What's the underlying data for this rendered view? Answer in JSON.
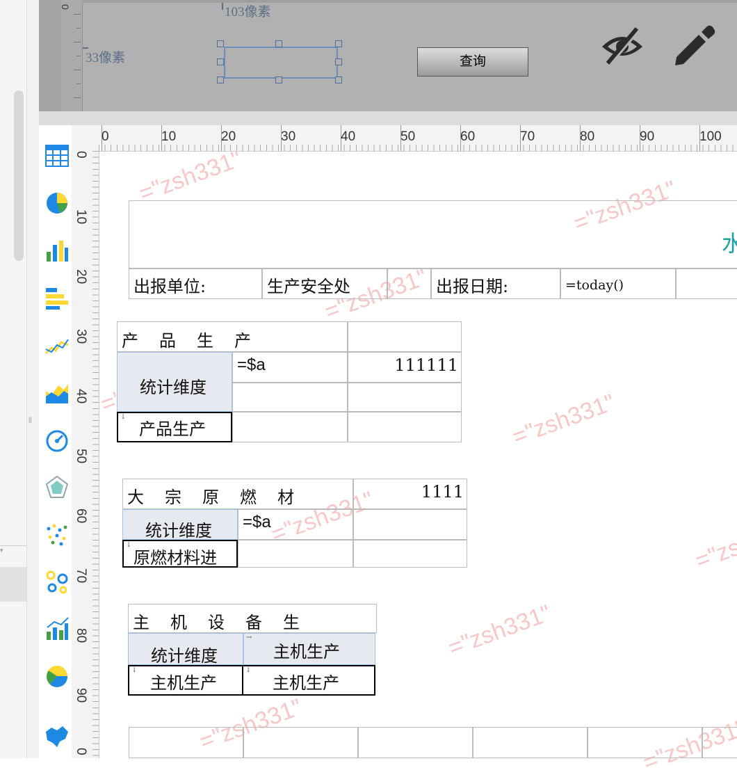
{
  "param_panel": {
    "ruler_top_label": "0",
    "width_label": "103像素",
    "height_label": "33像素",
    "query_button": "查询"
  },
  "ruler": {
    "h_ticks": [
      "0",
      "10",
      "20",
      "30",
      "40",
      "50",
      "60",
      "70",
      "80",
      "90",
      "100"
    ],
    "v_ticks": [
      "0",
      "10",
      "20",
      "30",
      "40",
      "50",
      "60",
      "70",
      "80",
      "90",
      "0"
    ]
  },
  "watermark": "=\"zsh331\"",
  "chart_icons": [
    "table-icon",
    "pie-chart-icon",
    "bar-chart-icon",
    "horizontal-bar-icon",
    "line-chart-icon",
    "area-chart-icon",
    "gauge-icon",
    "radar-chart-icon",
    "scatter-icon",
    "bubble-icon",
    "combo-chart-icon",
    "pie3d-icon",
    "map-icon"
  ],
  "report": {
    "title_partial": "水",
    "unit_label": "出报单位:",
    "unit_value": "生产安全处",
    "date_label": "出报日期:",
    "date_value": "=today()",
    "t1": {
      "title": "产品生产",
      "dim": "统计维度",
      "formula": "=$a",
      "value": "111111",
      "sub": "产品生产"
    },
    "t2": {
      "title": "大宗原燃材",
      "value": "1111",
      "dim": "统计维度",
      "formula": "=$a",
      "sub": "原燃材料进"
    },
    "t3": {
      "title": "主机设备生",
      "dim": "统计维度",
      "col2": "主机生产",
      "sub1": "主机生产",
      "sub2": "主机生产"
    }
  },
  "colors": {
    "accent": "#1aa3a3",
    "watermark": "#f8c8c8",
    "header_fill": "#e6e9ef"
  }
}
